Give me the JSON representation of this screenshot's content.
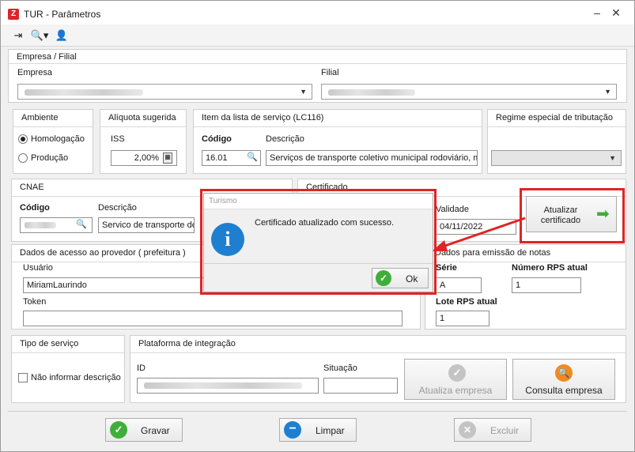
{
  "window": {
    "title": "TUR - Parâmetros",
    "logo_text": "Z"
  },
  "empresa_filial": {
    "header": "Empresa / Filial",
    "empresa_label": "Empresa",
    "filial_label": "Filial"
  },
  "ambiente": {
    "header": "Ambiente",
    "options": [
      "Homologação",
      "Produção"
    ],
    "selected": "Homologação"
  },
  "aliquota": {
    "header": "Alíquota sugerida",
    "iss_label": "ISS",
    "iss_value": "2,00%"
  },
  "item_servico": {
    "header": "Item da lista de serviço (LC116)",
    "codigo_label": "Código",
    "descricao_label": "Descrição",
    "codigo_value": "16.01",
    "descricao_value": "Serviços de transporte coletivo municipal rodoviário, me"
  },
  "regime": {
    "header": "Regime especial de tributação"
  },
  "cnae": {
    "header": "CNAE",
    "codigo_label": "Código",
    "descricao_label": "Descrição",
    "descricao_value": "Servico de transporte de"
  },
  "certificado": {
    "header": "Certificado",
    "validade_label": "Validade",
    "validade_value": "04/11/2022",
    "atualizar_label": "Atualizar certificado"
  },
  "acesso": {
    "header": "Dados de acesso ao provedor ( prefeitura )",
    "usuario_label": "Usuário",
    "usuario_value": "MiriamLaurindo",
    "token_label": "Token"
  },
  "emissao": {
    "header": "Dados para emissão de notas",
    "serie_label": "Série",
    "serie_value": "A",
    "numero_label": "Número RPS atual",
    "numero_value": "1",
    "lote_label": "Lote RPS atual",
    "lote_value": "1"
  },
  "tipo_servico": {
    "header": "Tipo de serviço",
    "nao_informar_label": "Não informar descrição"
  },
  "plataforma": {
    "header": "Plataforma de integração",
    "id_label": "ID",
    "situacao_label": "Situação",
    "atualiza_label": "Atualiza empresa",
    "consulta_label": "Consulta empresa"
  },
  "footer": {
    "gravar": "Gravar",
    "limpar": "Limpar",
    "excluir": "Excluir"
  },
  "dialog": {
    "title": "Turismo",
    "message": "Certificado atualizado com sucesso.",
    "ok": "Ok",
    "icon_text": "i"
  },
  "colors": {
    "highlight": "#e02424",
    "accent_green": "#3fae3a",
    "accent_blue": "#1e7fd0",
    "accent_orange": "#f08a1e"
  }
}
